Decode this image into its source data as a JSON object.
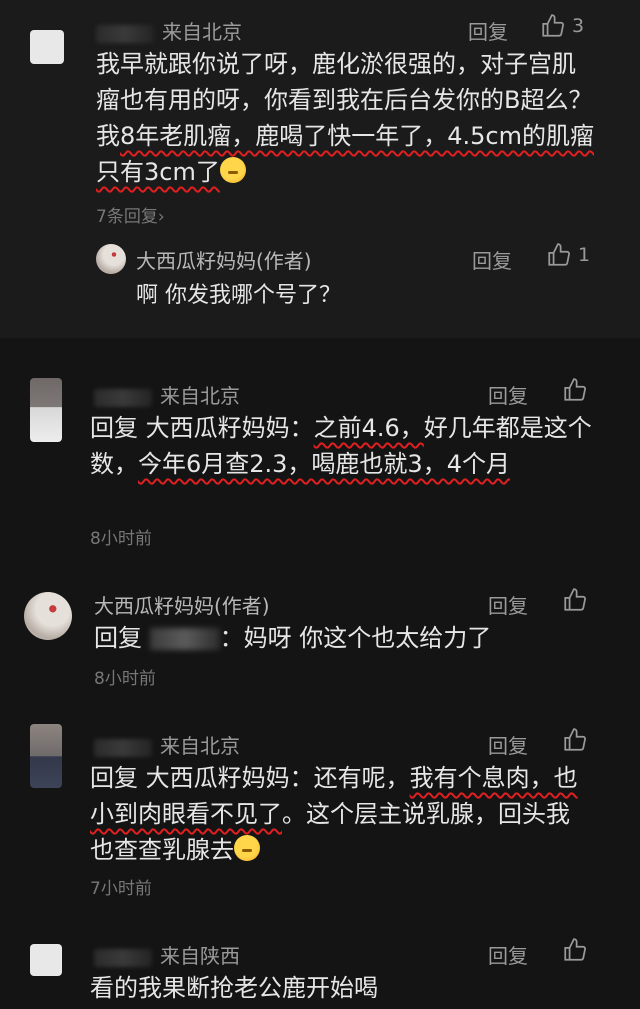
{
  "reply_label": "回复",
  "comments": [
    {
      "location": "来自北京",
      "likes": "3",
      "text_parts": [
        "我早就跟你说了呀，鹿化淤很强的，对子宫肌瘤也有用的呀，你看到我在后台发你的B超么？我",
        "8年老肌瘤，鹿喝了快一年了，4.5cm的肌瘤只有3cm了"
      ],
      "sub_replies": "7条回复›",
      "reply": {
        "author": "大西瓜籽妈妈(作者)",
        "likes": "1",
        "text": "啊 你发我哪个号了？"
      }
    },
    {
      "location": "来自北京",
      "text_parts": [
        "回复 大西瓜籽妈妈：",
        "之前4.6，",
        "好几年都是这个数，",
        "今年6月查2.3，喝鹿也就3，4个月"
      ],
      "time": "8小时前"
    },
    {
      "author": "大西瓜籽妈妈(作者)",
      "text_prefix": "回复",
      "text_suffix": "：妈呀 你这个也太给力了",
      "time": "8小时前"
    },
    {
      "location": "来自北京",
      "text_parts": [
        "回复 大西瓜籽妈妈：还有呢，",
        "我有个息肉，也小到肉眼看不见了",
        "。这个层主说乳腺，回头我也查查乳腺去"
      ],
      "time": "7小时前"
    },
    {
      "location": "来自陕西",
      "text": "看的我果断抢老公鹿开始喝"
    }
  ]
}
